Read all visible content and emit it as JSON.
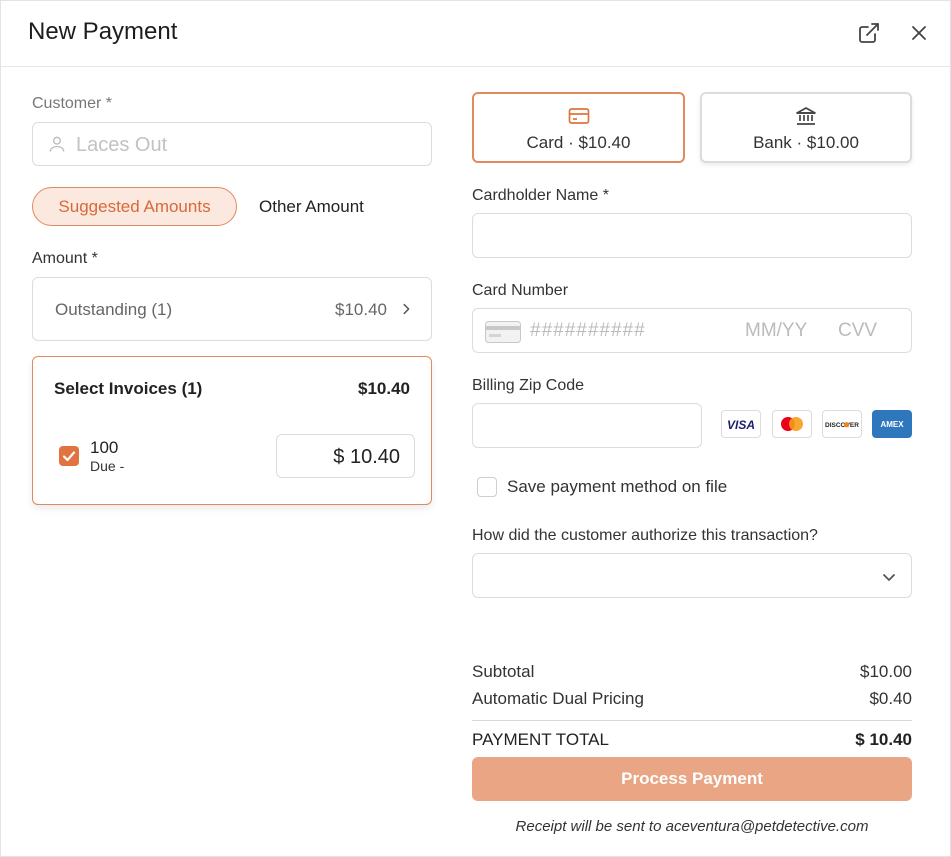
{
  "header": {
    "title": "New Payment",
    "open_icon": "external-link-icon",
    "close_icon": "close-icon"
  },
  "customer": {
    "label": "Customer *",
    "placeholder": "Laces Out"
  },
  "amount_tabs": {
    "suggested": "Suggested Amounts",
    "other": "Other Amount",
    "active": "suggested"
  },
  "amount": {
    "label": "Amount *",
    "outstanding_label": "Outstanding (1)",
    "outstanding_value": "$10.40"
  },
  "invoices": {
    "title": "Select Invoices (1)",
    "total": "$10.40",
    "items": [
      {
        "number": "100",
        "due": "Due  -",
        "amount": "$ 10.40",
        "checked": true
      }
    ]
  },
  "methods": {
    "card": "Card · $10.40",
    "bank": "Bank · $10.00",
    "selected": "card"
  },
  "card_form": {
    "cardholder_label": "Cardholder Name *",
    "card_number_label": "Card Number",
    "card_number_placeholder": "##########",
    "expiry_placeholder": "MM/YY",
    "cvv_placeholder": "CVV",
    "zip_label": "Billing Zip Code",
    "brands": [
      "VISA",
      "MASTERCARD",
      "DISCOVER",
      "AMEX"
    ]
  },
  "save_method": {
    "label": "Save payment method on file",
    "checked": false
  },
  "authorization": {
    "label": "How did the customer authorize this transaction?",
    "value": ""
  },
  "summary": {
    "subtotal_label": "Subtotal",
    "subtotal_value": "$10.00",
    "dual_label": "Automatic Dual Pricing",
    "dual_value": "$0.40",
    "total_label": "PAYMENT TOTAL",
    "total_value": "$ 10.40"
  },
  "actions": {
    "process": "Process Payment",
    "receipt_note": "Receipt will be sent to aceventura@petdetective.com"
  },
  "colors": {
    "accent": "#e0733f",
    "accent_light": "#fbe8de",
    "button_disabled": "#eaa584"
  }
}
